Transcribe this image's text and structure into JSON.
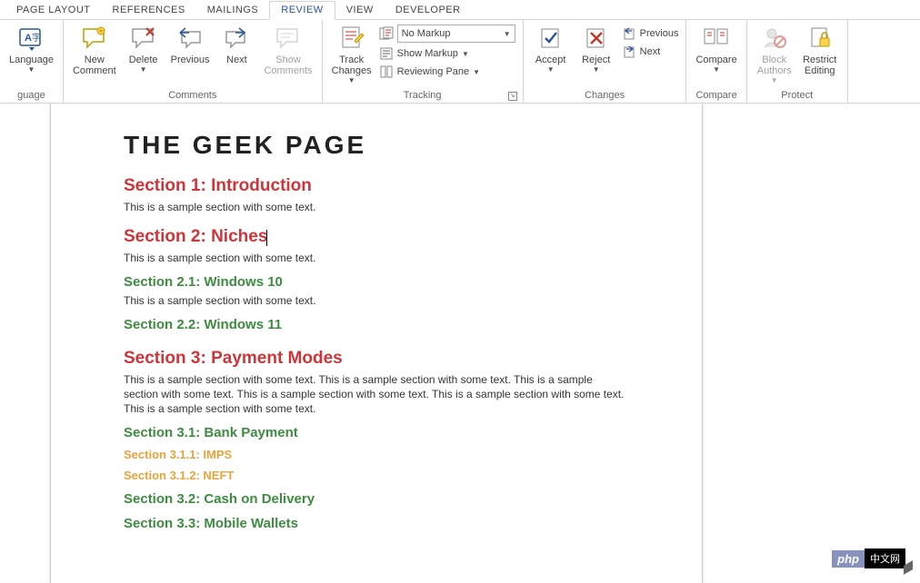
{
  "tabs": {
    "page_layout": "PAGE LAYOUT",
    "references": "REFERENCES",
    "mailings": "MAILINGS",
    "review": "REVIEW",
    "view": "VIEW",
    "developer": "DEVELOPER"
  },
  "ribbon": {
    "language": {
      "label": "Language",
      "group": "guage"
    },
    "comments": {
      "new": "New\nComment",
      "delete": "Delete",
      "previous": "Previous",
      "next": "Next",
      "show": "Show\nComments",
      "group": "Comments"
    },
    "tracking": {
      "track": "Track\nChanges",
      "markup_selected": "No Markup",
      "show_markup": "Show Markup",
      "reviewing": "Reviewing Pane",
      "group": "Tracking"
    },
    "changes": {
      "accept": "Accept",
      "reject": "Reject",
      "previous": "Previous",
      "next": "Next",
      "group": "Changes"
    },
    "compare": {
      "label": "Compare",
      "group": "Compare"
    },
    "protect": {
      "block": "Block\nAuthors",
      "restrict": "Restrict\nEditing",
      "group": "Protect"
    }
  },
  "doc": {
    "title": "THE GEEK PAGE",
    "s1": "Section 1: Introduction",
    "s1b": "This is a sample section with some text.",
    "s2": "Section 2: Niches",
    "s2b": "This is a sample section with some text.",
    "s21": "Section 2.1: Windows 10",
    "s21b": "This is a sample section with some text.",
    "s22": "Section 2.2: Windows 11",
    "s3": "Section 3: Payment Modes",
    "s3b": "This is a sample section with some text. This is a sample section with some text. This is a sample section with some text. This is a sample section with some text. This is a sample section with some text. This is a sample section with some text.",
    "s31": "Section 3.1: Bank Payment",
    "s311": "Section 3.1.1: IMPS",
    "s312": "Section 3.1.2: NEFT",
    "s32": "Section 3.2: Cash on Delivery",
    "s33": "Section 3.3: Mobile Wallets"
  },
  "badge": {
    "php": "php",
    "cn": "中文网"
  }
}
